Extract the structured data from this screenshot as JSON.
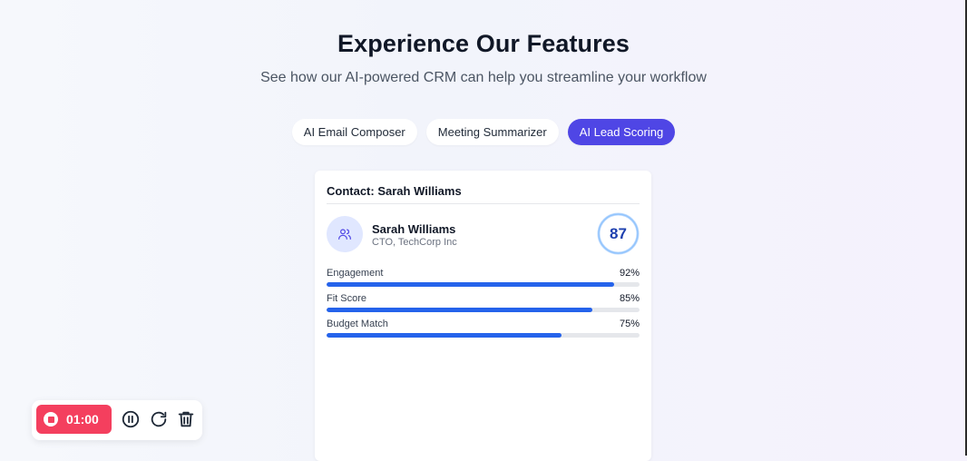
{
  "header": {
    "title": "Experience Our Features",
    "subtitle": "See how our AI-powered CRM can help you streamline your workflow"
  },
  "tabs": [
    {
      "label": "AI Email Composer",
      "active": false
    },
    {
      "label": "Meeting Summarizer",
      "active": false
    },
    {
      "label": "AI Lead Scoring",
      "active": true
    }
  ],
  "card": {
    "header": "Contact: Sarah Williams",
    "avatar_icon": "users-icon",
    "name": "Sarah Williams",
    "role": "CTO, TechCorp Inc",
    "score": "87",
    "metrics": [
      {
        "label": "Engagement",
        "value": "92%",
        "percent": 92
      },
      {
        "label": "Fit Score",
        "value": "85%",
        "percent": 85
      },
      {
        "label": "Budget Match",
        "value": "75%",
        "percent": 75
      }
    ]
  },
  "recorder": {
    "time": "01:00",
    "icons": [
      "stop-icon",
      "pause-icon",
      "restart-icon",
      "trash-icon"
    ]
  },
  "colors": {
    "accent": "#4f46e5",
    "bar": "#2563eb",
    "record": "#f43f5e",
    "score_text": "#1e40af"
  }
}
